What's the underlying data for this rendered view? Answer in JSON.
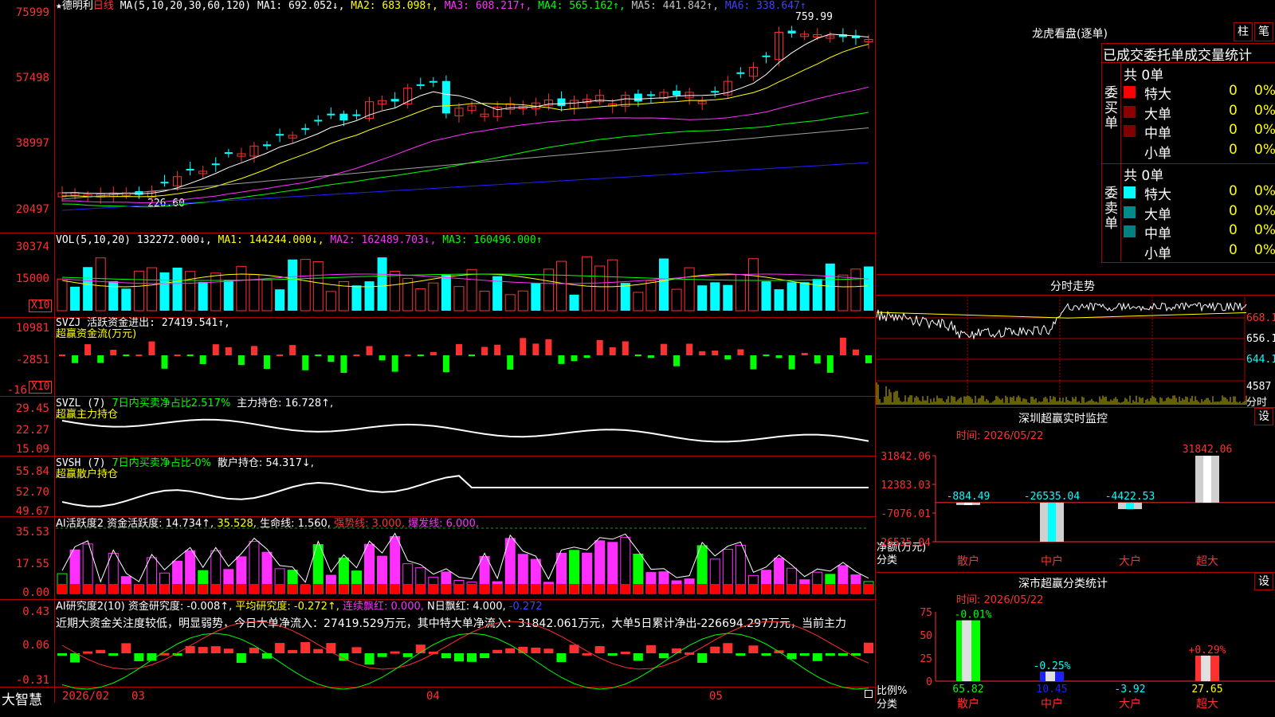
{
  "colors": {
    "up": "#ff3030",
    "down": "#00ffff",
    "grid": "#b00000",
    "ma1": "#ffffff",
    "ma2": "#ffff00",
    "ma3": "#ff30ff",
    "ma4": "#00ff00",
    "ma5": "#a0a0a0",
    "ma6": "#2020ff"
  },
  "main": {
    "stock_name": "德明利",
    "period": "日线",
    "ma_params": "MA(5,10,20,30,60,120)",
    "ma1": "MA1: 692.052↓,",
    "ma2": "MA2: 683.098↑,",
    "ma3": "MA3: 608.217↑,",
    "ma4": "MA4: 565.162↑,",
    "ma5": "MA5: 441.842↑,",
    "ma6": "MA6: 338.647↑",
    "y_labels": [
      "75999",
      "57498",
      "38997",
      "20497"
    ],
    "high_label": "759.99",
    "low_label": "226.60"
  },
  "vol": {
    "header": "VOL(5,10,20)",
    "value": "132272.000↓,",
    "ma1": "MA1: 144244.000↓,",
    "ma2": "MA2: 162489.703↓,",
    "ma3": "MA3: 160496.000↑",
    "y_labels": [
      "30374",
      "15000"
    ],
    "unit": "X10"
  },
  "svzj": {
    "header": "SVZJ  活跃资金进出: 27419.541↑,",
    "sub": "超赢资金流(万元)",
    "y_labels": [
      "10981",
      "-2851",
      "-16"
    ],
    "unit": "X10"
  },
  "svzl": {
    "header": "SVZL (7)",
    "green": "7日内买卖净占比2.517%",
    "main": "主力持仓: 16.728↑,",
    "sub": "超赢主力持仓",
    "y_labels": [
      "29.45",
      "22.27",
      "15.09"
    ]
  },
  "svsh": {
    "header": "SVSH (7)",
    "green": "7日内买卖净占比-0%",
    "main": "散户持仓: 54.317↓,",
    "sub": "超赢散户持仓",
    "y_labels": [
      "55.84",
      "52.70",
      "49.67"
    ]
  },
  "ai1": {
    "header": "AI活跃度2",
    "a": "资金活跃度: 14.734↑,",
    "b": "35.528,",
    "c": "生命线: 1.560,",
    "d": "强势线: 3.000,",
    "e": "爆发线: 6.000,",
    "y_labels": [
      "35.53",
      "17.55",
      "0.00"
    ]
  },
  "ai2": {
    "header": "AI研究度2(10)",
    "a": "资金研究度: -0.008↑,",
    "b": "平均研究度: -0.272↑,",
    "c": "连续飘红: 0.000,",
    "d": "N日飘红: 4.000,",
    "e": "-0.272",
    "comment": "近期大资金关注度较低，明显弱势，今日大单净流入：27419.529万元，其中特大单净流入：31842.061万元，大单5日累计净出-226694.297万元，当前主力",
    "y_labels": [
      "0.43",
      "0.06",
      "-0.31"
    ]
  },
  "xaxis": {
    "app": "大智慧",
    "labels": [
      "2026/02",
      "03",
      "04",
      "05"
    ]
  },
  "right": {
    "lhb_title": "龙虎看盘(逐单)",
    "btn_zhu": "柱",
    "btn_bi": "笔",
    "tab_text": "已成交委托单成交量统计",
    "buy_label": "委买单",
    "sell_label": "委卖单",
    "buy_total": "共 0单",
    "sell_total": "共 0单",
    "buy_rows": [
      {
        "name": "特大",
        "v": "0",
        "p": "0%",
        "c": "#ff0000"
      },
      {
        "name": "大单",
        "v": "0",
        "p": "0%",
        "c": "#8b0000"
      },
      {
        "name": "中单",
        "v": "0",
        "p": "0%",
        "c": "#800000"
      },
      {
        "name": "小单",
        "v": "0",
        "p": "0%",
        "c": ""
      }
    ],
    "sell_rows": [
      {
        "name": "特大",
        "v": "0",
        "p": "0%",
        "c": "#00ffff"
      },
      {
        "name": "大单",
        "v": "0",
        "p": "0%",
        "c": "#008b8b"
      },
      {
        "name": "中单",
        "v": "0",
        "p": "0%",
        "c": "#008080"
      },
      {
        "name": "小单",
        "v": "0",
        "p": "0%",
        "c": ""
      }
    ],
    "fs_title": "分时走势",
    "fs_y": [
      "668.1",
      "656.1",
      "644.1",
      "4587"
    ],
    "fs_unit": "分时",
    "sz_title": "深圳超赢实时监控",
    "sz_btn": "设",
    "sz_time": "时间: 2026/05/22",
    "sz_y": [
      "31842.06",
      "12383.03",
      "-7076.01",
      "-26535.04"
    ],
    "sz_ylabel": "净额(万元)",
    "sz_xlabel": "分类",
    "sz_cats": [
      "散户",
      "中户",
      "大户",
      "超大"
    ],
    "sz_vals_text": [
      "-884.49",
      "-26535.04",
      "-4422.53",
      "31842.06"
    ],
    "fl_title": "深市超赢分类统计",
    "fl_btn": "设",
    "fl_time": "时间: 2026/05/22",
    "fl_y": [
      "75",
      "50",
      "25",
      "0"
    ],
    "fl_ylabel": "比例%",
    "fl_xlabel": "分类",
    "fl_cats": [
      "散户",
      "中户",
      "大户",
      "超大"
    ],
    "fl_top": [
      "-0.01%",
      "-0.25%",
      "",
      "+0.29%"
    ],
    "fl_bot": [
      "65.82",
      "10.45",
      "-3.92",
      "27.65"
    ]
  },
  "chart_data": [
    {
      "type": "bar",
      "name": "深圳超赢实时监控",
      "categories": [
        "散户",
        "中户",
        "大户",
        "超大"
      ],
      "values": [
        -884.49,
        -26535.04,
        -4422.53,
        31842.06
      ],
      "ylabel": "净额(万元)",
      "ylim": [
        -26535.04,
        31842.06
      ]
    },
    {
      "type": "bar",
      "name": "深市超赢分类统计",
      "categories": [
        "散户",
        "中户",
        "大户",
        "超大"
      ],
      "values": [
        65.82,
        10.45,
        -3.92,
        27.65
      ],
      "ylabel": "比例%",
      "ylim": [
        0,
        75
      ]
    }
  ]
}
